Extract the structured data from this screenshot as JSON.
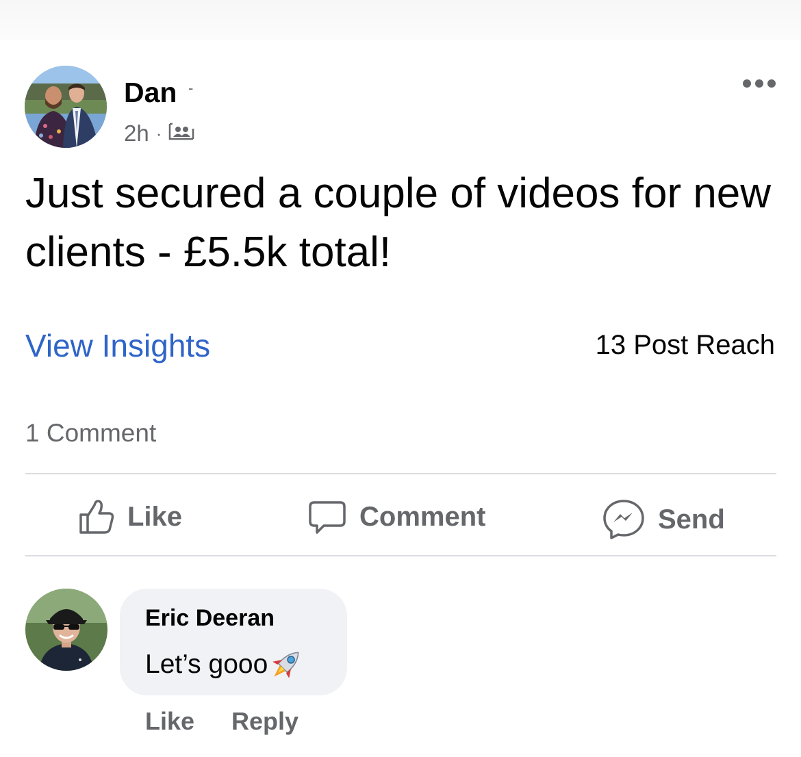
{
  "post": {
    "author": "Dan",
    "timestamp": "2h",
    "separator": "·",
    "audience_icon": "group-audience-icon",
    "text": "Just secured a couple of videos for new clients - £5.5k total!",
    "more_icon": "more-options-icon"
  },
  "stats": {
    "insights_link": "View Insights",
    "reach": "13 Post Reach",
    "comments_count": "1 Comment"
  },
  "actions": {
    "like": {
      "label": "Like",
      "icon": "thumbs-up-icon"
    },
    "comment": {
      "label": "Comment",
      "icon": "comment-bubble-icon"
    },
    "send": {
      "label": "Send",
      "icon": "messenger-icon"
    }
  },
  "comment": {
    "author": "Eric Deeran",
    "text": "Let’s gooo",
    "emoji_icon": "rocket-icon",
    "like_label": "Like",
    "reply_label": "Reply"
  },
  "colors": {
    "link_blue": "#2f64c8",
    "muted_gray": "#65676b",
    "bubble_bg": "#f0f2f5",
    "divider": "#dcdde0"
  }
}
